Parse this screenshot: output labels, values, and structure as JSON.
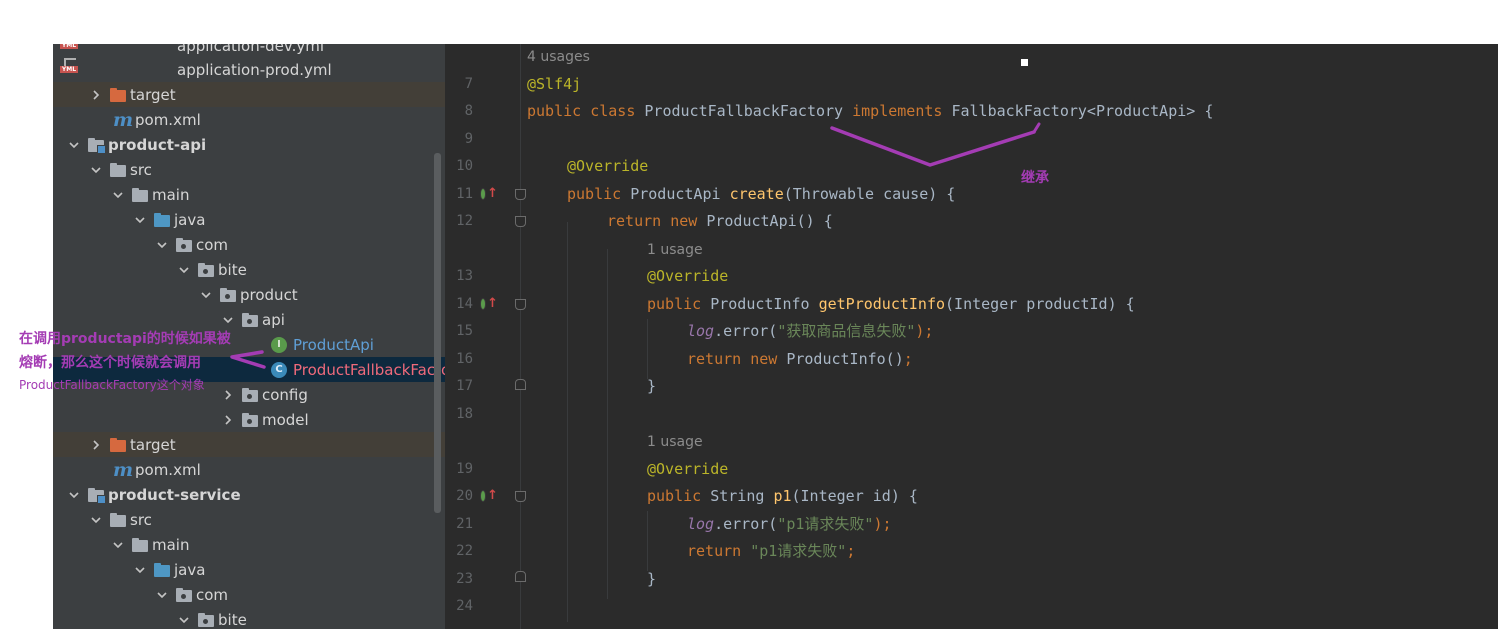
{
  "tree": {
    "rows": [
      {
        "label": "application-dev.yml",
        "icon": "yml-icon"
      },
      {
        "label": "application-prod.yml",
        "icon": "yml-icon"
      },
      {
        "label": "target",
        "icon": "folder-orange-icon"
      },
      {
        "label": "pom.xml",
        "icon": "maven-icon"
      },
      {
        "label": "product-api",
        "icon": "module-folder-icon"
      },
      {
        "label": "src",
        "icon": "folder-icon"
      },
      {
        "label": "main",
        "icon": "folder-icon"
      },
      {
        "label": "java",
        "icon": "folder-blue-icon"
      },
      {
        "label": "com",
        "icon": "package-icon"
      },
      {
        "label": "bite",
        "icon": "package-icon"
      },
      {
        "label": "product",
        "icon": "package-icon"
      },
      {
        "label": "api",
        "icon": "package-icon"
      },
      {
        "label": "ProductApi",
        "icon": "interface-icon",
        "badge": "I"
      },
      {
        "label": "ProductFallbackFactory",
        "icon": "class-icon",
        "badge": "C"
      },
      {
        "label": "config",
        "icon": "package-icon"
      },
      {
        "label": "model",
        "icon": "package-icon"
      },
      {
        "label": "target",
        "icon": "folder-orange-icon"
      },
      {
        "label": "pom.xml",
        "icon": "maven-icon"
      },
      {
        "label": "product-service",
        "icon": "module-folder-icon"
      },
      {
        "label": "src",
        "icon": "folder-icon"
      },
      {
        "label": "main",
        "icon": "folder-icon"
      },
      {
        "label": "java",
        "icon": "folder-blue-icon"
      },
      {
        "label": "com",
        "icon": "package-icon"
      },
      {
        "label": "bite",
        "icon": "package-icon"
      }
    ]
  },
  "editor": {
    "hints": {
      "usages_4": "4 usages",
      "usage_1a": "1 usage",
      "usage_1b": "1 usage"
    },
    "line_numbers": [
      "7",
      "8",
      "9",
      "10",
      "11",
      "12",
      "13",
      "14",
      "15",
      "16",
      "17",
      "18",
      "19",
      "20",
      "21",
      "22",
      "23",
      "24"
    ],
    "code": {
      "l7": "@Slf4j",
      "l8_kw1": "public class ",
      "l8_name": "ProductFallbackFactory ",
      "l8_kw2": "implements ",
      "l8_rest": "FallbackFactory<ProductApi> {",
      "l10": "@Override",
      "l11_kw": "public ",
      "l11_type": "ProductApi ",
      "l11_fn": "create",
      "l11_rest": "(Throwable cause) {",
      "l12_kw": "return new ",
      "l12_rest": "ProductApi() {",
      "l13": "@Override",
      "l14_kw": "public ",
      "l14_type": "ProductInfo ",
      "l14_fn": "getProductInfo",
      "l14_rest": "(Integer productId) {",
      "l15_log": "log",
      "l15_mid": ".error(",
      "l15_str": "\"获取商品信息失败\"",
      "l15_end": ");",
      "l16_kw": "return new ",
      "l16_rest": "ProductInfo()",
      "l16_end": ";",
      "l17": "}",
      "l19": "@Override",
      "l20_kw": "public ",
      "l20_type": "String ",
      "l20_fn": "p1",
      "l20_rest": "(Integer id) {",
      "l21_log": "log",
      "l21_mid": ".error(",
      "l21_str": "\"p1请求失败\"",
      "l21_end": ");",
      "l22_kw": "return ",
      "l22_str": "\"p1请求失败\"",
      "l22_end": ";",
      "l23": "}"
    }
  },
  "annotations": {
    "inherit": "继承",
    "left_line1": "在调用productapi的时候如果被",
    "left_line2": "熔断，那么这个时候就会调用",
    "left_line3": "ProductFallbackFactory这个对象"
  },
  "colors": {
    "annotation": "#a43cb4",
    "tree_bg": "#3c3f41",
    "editor_bg": "#2b2b2b",
    "keyword": "#cc7832",
    "annotation_code": "#bbb529",
    "function": "#ffc66d",
    "string": "#6a8759"
  }
}
